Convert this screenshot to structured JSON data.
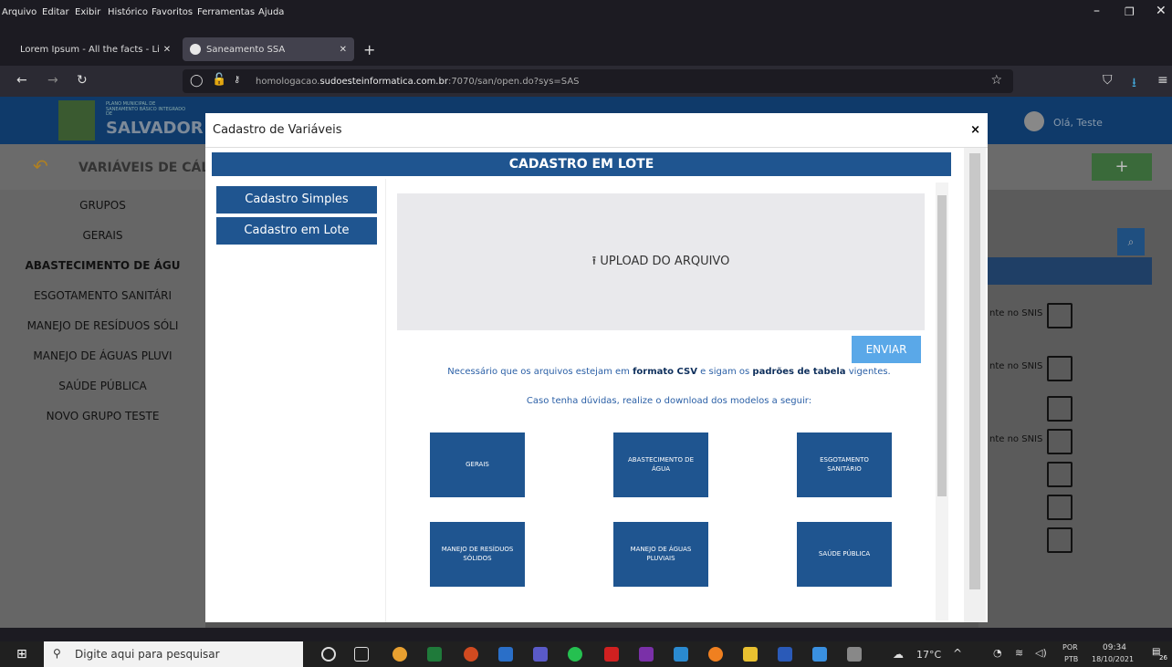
{
  "browser": {
    "menu": [
      "Arquivo",
      "Editar",
      "Exibir",
      "Histórico",
      "Favoritos",
      "Ferramentas",
      "Ajuda"
    ],
    "tabs": [
      {
        "label": "Lorem Ipsum - All the facts - Li"
      },
      {
        "label": "Saneamento SSA"
      }
    ],
    "url_prefix": "homologacao.",
    "url_domain": "sudoesteinformatica.com.br",
    "url_suffix": ":7070/san/open.do?sys=SAS"
  },
  "app": {
    "logo_small": "PLANO MUNICIPAL DE SANEAMENTO BÁSICO INTEGRADO DE",
    "logo_big": "SALVADOR",
    "user_greeting": "Olá, Teste",
    "page_title": "VARIÁVEIS DE CÁL",
    "left_nav": [
      "GRUPOS",
      "GERAIS",
      "ABASTECIMENTO DE ÁGU",
      "ESGOTAMENTO SANITÁRI",
      "MANEJO DE RESÍDUOS SÓLI",
      "MANEJO DE ÁGUAS PLUVI",
      "SAÚDE PÚBLICA",
      "NOVO GRUPO TESTE"
    ],
    "right_rows": [
      "nte no SNIS",
      "nte no SNIS",
      "",
      "nte no SNIS",
      "",
      "",
      ""
    ]
  },
  "modal": {
    "title": "Cadastro de Variáveis",
    "close": "×",
    "banner": "CADASTRO EM LOTE",
    "side_buttons": [
      "Cadastro Simples",
      "Cadastro em Lote"
    ],
    "upload_label": "UPLOAD DO ARQUIVO",
    "submit_label": "ENVIAR",
    "note1_a": "Necessário que os arquivos estejam em ",
    "note1_b": "formato CSV",
    "note1_c": " e sigam os ",
    "note1_d": "padrões de tabela",
    "note1_e": " vigentes.",
    "note2": "Caso tenha dúvidas, realize o download dos modelos a seguir:",
    "downloads": [
      "GERAIS",
      "ABASTECIMENTO DE ÁGUA",
      "ESGOTAMENTO SANITÁRIO",
      "MANEJO DE RESÍDUOS SÓLIDOS",
      "MANEJO DE ÁGUAS PLUVIAIS",
      "SAÚDE PÚBLICA"
    ]
  },
  "taskbar": {
    "search_placeholder": "Digite aqui para pesquisar",
    "weather": "17°C",
    "lang": "POR",
    "lang2": "PTB",
    "time": "09:34",
    "date": "18/10/2021",
    "notif_count": "26"
  }
}
